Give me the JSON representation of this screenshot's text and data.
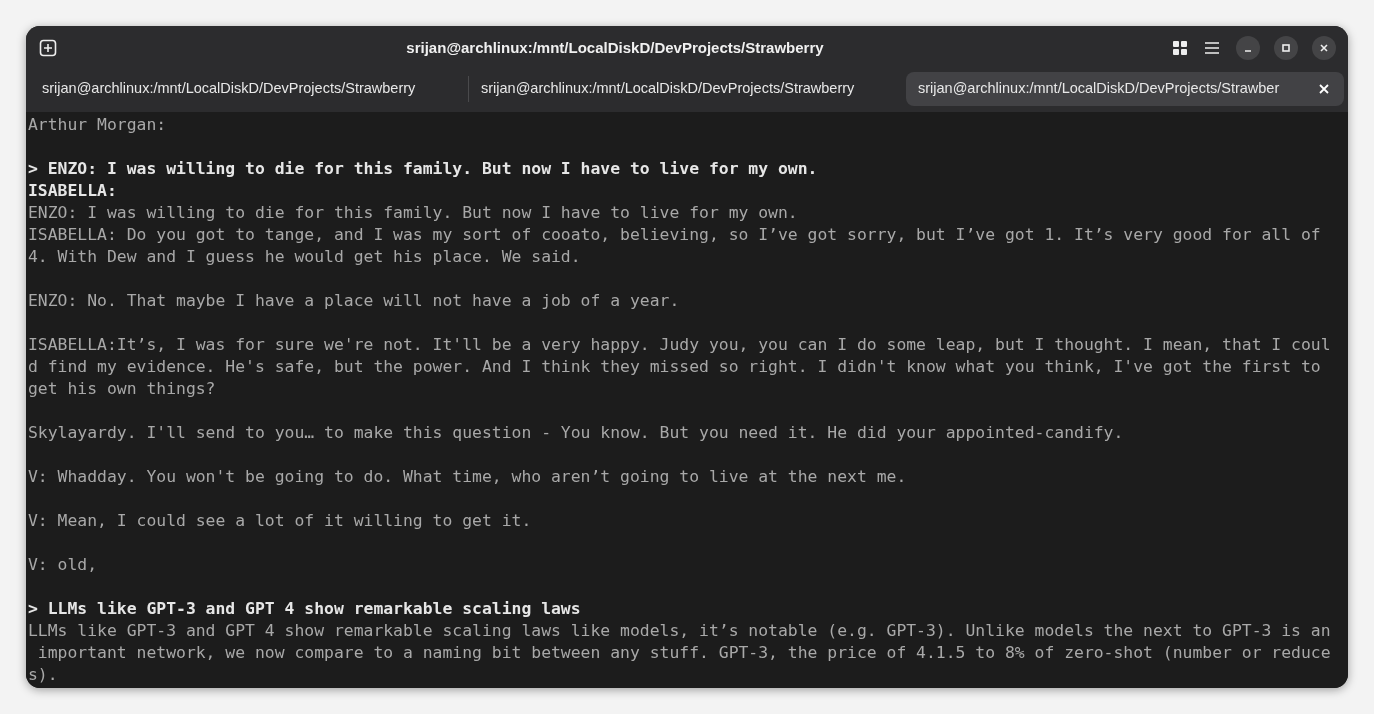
{
  "window": {
    "title": "srijan@archlinux:/mnt/LocalDiskD/DevProjects/Strawberry"
  },
  "tabs": [
    {
      "label": "srijan@archlinux:/mnt/LocalDiskD/DevProjects/Strawberry",
      "selected": false
    },
    {
      "label": "srijan@archlinux:/mnt/LocalDiskD/DevProjects/Strawberry",
      "selected": false
    },
    {
      "label": "srijan@archlinux:/mnt/LocalDiskD/DevProjects/Strawber",
      "selected": true
    }
  ],
  "terminal_lines": [
    {
      "kind": "plain",
      "text": "Arthur Morgan:"
    },
    {
      "kind": "blank"
    },
    {
      "kind": "bold",
      "text": "> ENZO: I was willing to die for this family. But now I have to live for my own."
    },
    {
      "kind": "bold",
      "text": "ISABELLA:"
    },
    {
      "kind": "plain",
      "text": "ENZO: I was willing to die for this family. But now I have to live for my own."
    },
    {
      "kind": "plain",
      "text": "ISABELLA: Do you got to tange, and I was my sort of cooato, believing, so I’ve got sorry, but I’ve got 1. It’s very good for all of"
    },
    {
      "kind": "plain",
      "text": "4. With Dew and I guess he would get his place. We said."
    },
    {
      "kind": "blank"
    },
    {
      "kind": "plain",
      "text": "ENZO: No. That maybe I have a place will not have a job of a year."
    },
    {
      "kind": "blank"
    },
    {
      "kind": "plain",
      "text": "ISABELLA:It’s, I was for sure we're not. It'll be a very happy. Judy you, you can I do some leap, but I thought. I mean, that I coul"
    },
    {
      "kind": "plain",
      "text": "d find my evidence. He's safe, but the power. And I think they missed so right. I didn't know what you think, I've got the first to"
    },
    {
      "kind": "plain",
      "text": "get his own things?"
    },
    {
      "kind": "blank"
    },
    {
      "kind": "plain",
      "text": "Skylayardy. I'll send to you… to make this question - You know. But you need it. He did your appointed-candify."
    },
    {
      "kind": "blank"
    },
    {
      "kind": "plain",
      "text": "V: Whadday. You won't be going to do. What time, who aren’t going to live at the next me."
    },
    {
      "kind": "blank"
    },
    {
      "kind": "plain",
      "text": "V: Mean, I could see a lot of it willing to get it."
    },
    {
      "kind": "blank"
    },
    {
      "kind": "plain",
      "text": "V: old,"
    },
    {
      "kind": "blank"
    },
    {
      "kind": "bold",
      "text": "> LLMs like GPT-3 and GPT 4 show remarkable scaling laws"
    },
    {
      "kind": "plain",
      "text": "LLMs like GPT-3 and GPT 4 show remarkable scaling laws like models, it’s notable (e.g. GPT-3). Unlike models the next to GPT-3 is an"
    },
    {
      "kind": "plain",
      "text": " important network, we now compare to a naming bit between any stuff. GPT-3, the price of 4.1.5 to 8% of zero-shot (number or reduce"
    },
    {
      "kind": "plain",
      "text": "s)."
    }
  ]
}
